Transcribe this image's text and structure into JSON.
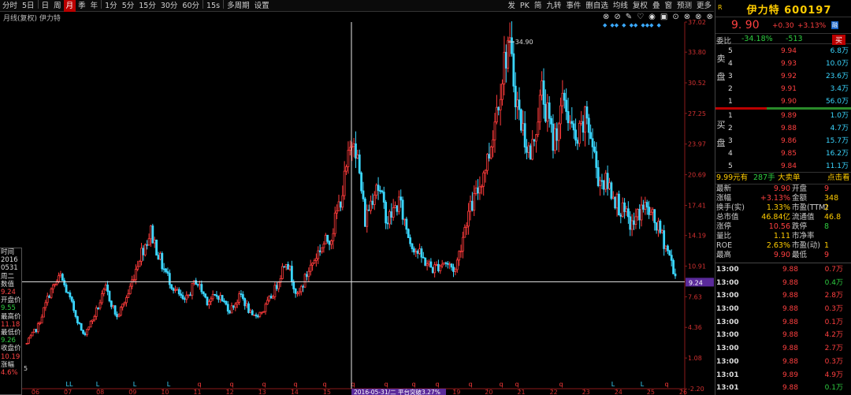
{
  "toolbar": {
    "items": [
      "分时",
      "5日",
      "日",
      "周",
      "月",
      "季",
      "年",
      "1分",
      "5分",
      "15分",
      "30分",
      "60分",
      "15s",
      "多周期",
      "设置"
    ],
    "active_index": 4,
    "right_items": [
      "发",
      "PK",
      "简",
      "九转",
      "事件",
      "删自选",
      "均线",
      "复权",
      "叠",
      "窗",
      "预测",
      "更多"
    ]
  },
  "subbar": {
    "label": "月线(复权) 伊力特",
    "icons": [
      "⊗",
      "⊘",
      "✎",
      "♡",
      "◉",
      "▣",
      "⊙",
      "⊗",
      "⊗",
      "⊗"
    ],
    "diamonds": [
      "◆",
      "◆◆",
      "◆",
      "◆◆",
      "◆◆◆",
      "◆"
    ]
  },
  "chart_data": {
    "type": "candlestick",
    "title": "月线(复权) 伊力特",
    "y_ticks": [
      "37.02",
      "33.80",
      "30.52",
      "27.25",
      "23.97",
      "20.69",
      "17.41",
      "14.19",
      "10.91",
      "7.63",
      "4.36",
      "1.08",
      "-2.20"
    ],
    "x_ticks": [
      "06",
      "07",
      "08",
      "09",
      "10",
      "11",
      "12",
      "13",
      "14",
      "15",
      "16",
      "17",
      "18",
      "19",
      "20",
      "21",
      "22",
      "23",
      "24",
      "25",
      "26"
    ],
    "crosshair_price": "9.24",
    "crosshair_date_label": "2016-05-31/二  平台突破3.27%",
    "max_label": "34.90",
    "low_label": "5",
    "yrange": [
      -2.2,
      37.02
    ],
    "marker_text": [
      "LL",
      "L",
      "L",
      "L",
      "q",
      "q",
      "q",
      "q",
      "q",
      "q",
      "q",
      "q",
      "q",
      "q",
      "q",
      "q",
      "q",
      "L",
      "L",
      "q"
    ]
  },
  "infopanel": {
    "rows": [
      {
        "text": "时间",
        "cls": "v-wht"
      },
      {
        "text": "2016",
        "cls": "v-wht"
      },
      {
        "text": "0531",
        "cls": "v-wht"
      },
      {
        "text": "周二",
        "cls": "v-wht"
      },
      {
        "text": "数值",
        "cls": "v-wht"
      },
      {
        "text": "9.24",
        "cls": "v-red"
      },
      {
        "text": "开盘价",
        "cls": "v-wht"
      },
      {
        "text": "9.55",
        "cls": "v-grn"
      },
      {
        "text": "最高价",
        "cls": "v-wht"
      },
      {
        "text": "11.18",
        "cls": "v-red"
      },
      {
        "text": "最低价",
        "cls": "v-wht"
      },
      {
        "text": "9.26",
        "cls": "v-grn"
      },
      {
        "text": "收盘价",
        "cls": "v-wht"
      },
      {
        "text": "10.19",
        "cls": "v-red"
      },
      {
        "text": "涨幅",
        "cls": "v-wht"
      },
      {
        "text": "4.6%",
        "cls": "v-red"
      }
    ]
  },
  "quote": {
    "badge_r": "R",
    "name": "伊力特 600197",
    "price": "9. 90",
    "change": "+0.30",
    "pct": "+3.13%",
    "badge": "融",
    "wei_label": "委比",
    "wei_pct": "-34.18%",
    "wei_diff": "-513",
    "buy_btn": "买",
    "sell_side": "卖盘",
    "buy_side": "买盘",
    "sell": [
      {
        "lv": "5",
        "price": "9.94",
        "vol": "6.8万"
      },
      {
        "lv": "4",
        "price": "9.93",
        "vol": "10.0万"
      },
      {
        "lv": "3",
        "price": "9.92",
        "vol": "23.6万"
      },
      {
        "lv": "2",
        "price": "9.91",
        "vol": "3.4万"
      },
      {
        "lv": "1",
        "price": "9.90",
        "vol": "56.0万"
      }
    ],
    "buy": [
      {
        "lv": "1",
        "price": "9.89",
        "vol": "1.0万"
      },
      {
        "lv": "2",
        "price": "9.88",
        "vol": "4.7万"
      },
      {
        "lv": "3",
        "price": "9.86",
        "vol": "15.7万"
      },
      {
        "lv": "4",
        "price": "9.85",
        "vol": "16.2万"
      },
      {
        "lv": "5",
        "price": "9.84",
        "vol": "11.1万"
      }
    ],
    "extra": {
      "a": "9.99元有",
      "b": "287手",
      "c": "大卖单",
      "d": "点击看"
    },
    "stats": [
      {
        "l1": "最新",
        "v1": "9.90",
        "c1": "c-red",
        "l2": "开盘",
        "v2": "9",
        "c2": "c-red"
      },
      {
        "l1": "涨幅",
        "v1": "+3.13%",
        "c1": "c-red",
        "l2": "金额",
        "v2": "348",
        "c2": "c-yel"
      },
      {
        "l1": "换手(实)",
        "v1": "1.33%",
        "c1": "c-yel",
        "l2": "市盈(TTM)",
        "v2": "2",
        "c2": "c-yel"
      },
      {
        "l1": "总市值",
        "v1": "46.84亿",
        "c1": "c-yel",
        "l2": "流通值",
        "v2": "46.8",
        "c2": "c-yel"
      },
      {
        "l1": "涨停",
        "v1": "10.56",
        "c1": "c-red",
        "l2": "跌停",
        "v2": "8",
        "c2": "c-grn"
      },
      {
        "l1": "量比",
        "v1": "1.11",
        "c1": "c-yel",
        "l2": "市净率",
        "v2": "",
        "c2": "c-yel"
      },
      {
        "l1": "ROE",
        "v1": "2.63%",
        "c1": "c-yel",
        "l2": "市盈(动)",
        "v2": "1",
        "c2": "c-yel"
      },
      {
        "l1": "最高",
        "v1": "9.90",
        "c1": "c-red",
        "l2": "最低",
        "v2": "9",
        "c2": "c-red"
      }
    ],
    "ticks": [
      {
        "t": "13:00",
        "p": "9.88",
        "v": "0.7万",
        "c": "c-red"
      },
      {
        "t": "13:00",
        "p": "9.88",
        "v": "0.4万",
        "c": "c-grn"
      },
      {
        "t": "13:00",
        "p": "9.88",
        "v": "2.8万",
        "c": "c-red"
      },
      {
        "t": "13:00",
        "p": "9.88",
        "v": "0.3万",
        "c": "c-red"
      },
      {
        "t": "13:00",
        "p": "9.88",
        "v": "0.1万",
        "c": "c-red"
      },
      {
        "t": "13:00",
        "p": "9.88",
        "v": "4.2万",
        "c": "c-red"
      },
      {
        "t": "13:00",
        "p": "9.88",
        "v": "2.7万",
        "c": "c-red"
      },
      {
        "t": "13:00",
        "p": "9.88",
        "v": "0.3万",
        "c": "c-red"
      },
      {
        "t": "13:01",
        "p": "9.89",
        "v": "4.9万",
        "c": "c-red"
      },
      {
        "t": "13:01",
        "p": "9.88",
        "v": "0.1万",
        "c": "c-grn"
      },
      {
        "t": "13:01",
        "p": "9.88",
        "v": "0.5万",
        "c": "c-grn"
      }
    ]
  }
}
